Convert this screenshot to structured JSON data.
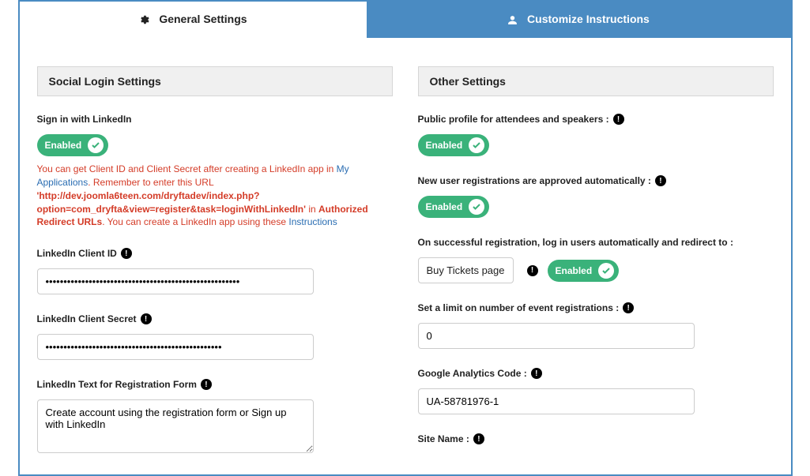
{
  "tabs": {
    "general": "General Settings",
    "customize": "Customize Instructions"
  },
  "left_panel": {
    "header": "Social Login Settings",
    "linkedin_signin_label": "Sign in with LinkedIn",
    "linkedin_signin_toggle": "Enabled",
    "help_pre": "You can get Client ID and Client Secret after creating a LinkedIn app in ",
    "help_myapps": "My Applications",
    "help_mid1": ". Remember to enter this URL ",
    "help_url": "'http://dev.joomla6teen.com/dryftadev/index.php?option=com_dryfta&view=register&task=loginWithLinkedIn'",
    "help_mid2": " in ",
    "help_auth": "Authorized Redirect URLs",
    "help_mid3": ". You can create a LinkedIn app using these ",
    "help_instr": "Instructions",
    "client_id_label": "LinkedIn Client ID",
    "client_id_value": "••••••••••••••••••••••••••••••••••••••••••••••••••••••",
    "client_secret_label": "LinkedIn Client Secret",
    "client_secret_value": "•••••••••••••••••••••••••••••••••••••••••••••••••",
    "reg_text_label": "LinkedIn Text for Registration Form",
    "reg_text_value": "Create account using the registration form or Sign up with LinkedIn"
  },
  "right_panel": {
    "header": "Other Settings",
    "public_profile_label": "Public profile for attendees and speakers :",
    "public_profile_toggle": "Enabled",
    "auto_approve_label": "New user registrations are approved automatically :",
    "auto_approve_toggle": "Enabled",
    "redirect_label": "On successful registration, log in users automatically and redirect to :",
    "redirect_page": "Buy Tickets page",
    "redirect_toggle": "Enabled",
    "limit_label": "Set a limit on number of event registrations :",
    "limit_value": "0",
    "ga_label": "Google Analytics Code :",
    "ga_value": "UA-58781976-1",
    "site_name_label": "Site Name :"
  }
}
